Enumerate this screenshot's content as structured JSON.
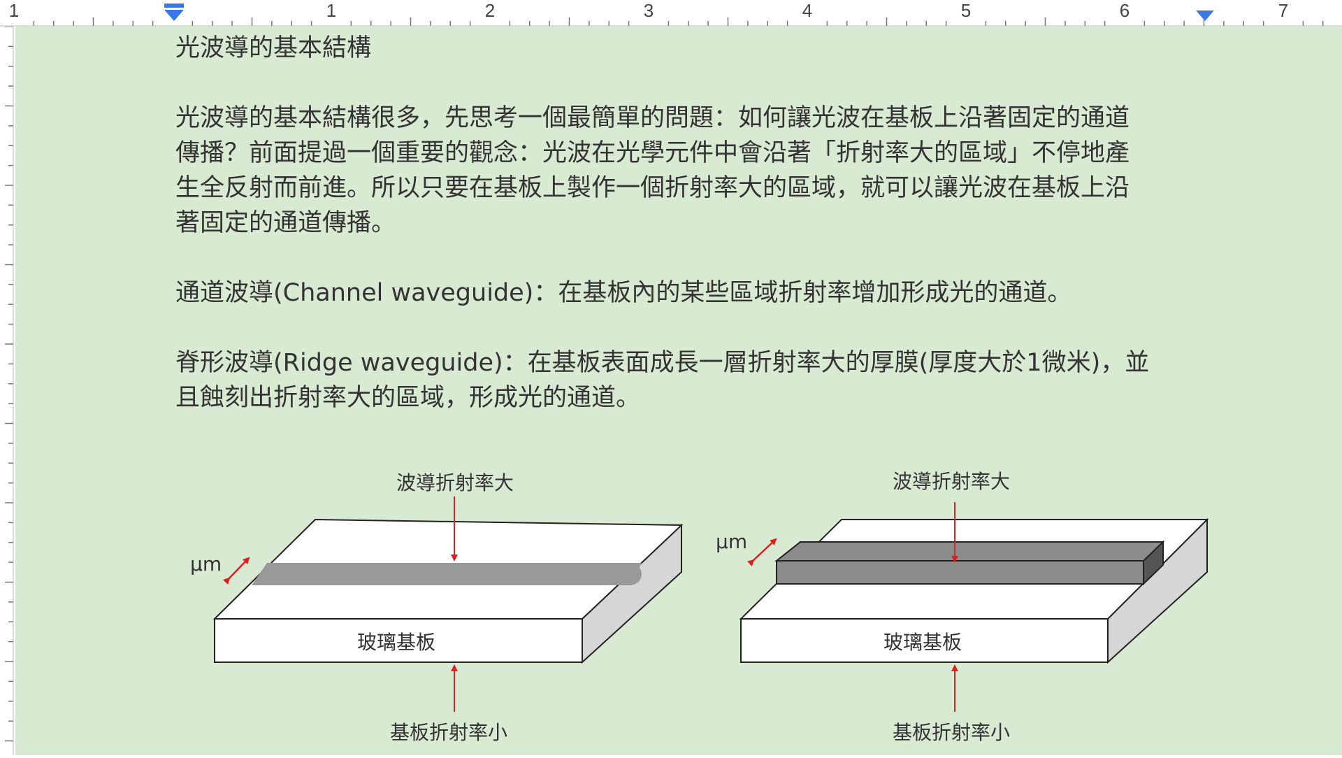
{
  "ruler": {
    "numbers": [
      "1",
      "1",
      "2",
      "3",
      "4",
      "5",
      "6",
      "7"
    ]
  },
  "doc": {
    "heading": "光波導的基本結構",
    "para1": [
      "光波導的基本結構很多，先思考一個最簡單的問題：如何讓光波在基板上沿著固定的通道",
      "傳播？前面提過一個重要的觀念：光波在光學元件中會沿著「折射率大的區域」不停地產",
      "生全反射而前進。所以只要在基板上製作一個折射率大的區域，就可以讓光波在基板上沿",
      "著固定的通道傳播。"
    ],
    "para2": "通道波導(Channel waveguide)：在基板內的某些區域折射率增加形成光的通道。",
    "para3": [
      "脊形波導(Ridge waveguide)：在基板表面成長一層折射率大的厚膜(厚度大於1微米)，並",
      "且蝕刻出折射率大的區域，形成光的通道。"
    ]
  },
  "diagrams": {
    "left": {
      "top_label": "波導折射率大",
      "unit_label": "µm",
      "substrate_label": "玻璃基板",
      "bottom_label": "基板折射率小"
    },
    "right": {
      "top_label": "波導折射率大",
      "unit_label": "µm",
      "substrate_label": "玻璃基板",
      "bottom_label": "基板折射率小"
    }
  },
  "colors": {
    "page_bg": "#d9ead3",
    "marker_blue": "#3b78e7",
    "arrow_red": "#e02020",
    "waveguide_gray": "#999999",
    "ridge_gray": "#8c8c8c"
  }
}
